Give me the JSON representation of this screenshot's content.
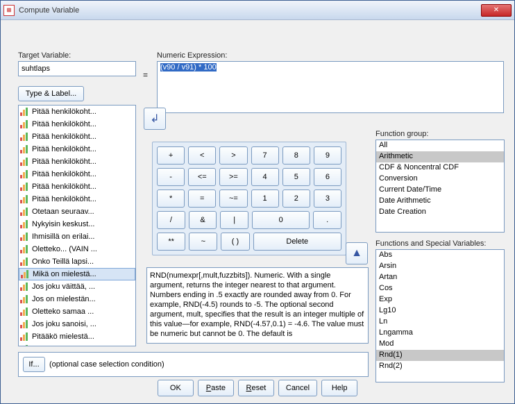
{
  "window": {
    "title": "Compute Variable"
  },
  "target": {
    "label": "Target Variable:",
    "value": "suhtlaps",
    "type_label_btn": "Type & Label..."
  },
  "eq": "=",
  "expression": {
    "label": "Numeric Expression:",
    "value": "(v90 / v91) * 100"
  },
  "variables": [
    "Pitää henkilökoht...",
    "Pitää henkilököht...",
    "Pitää henkilököht...",
    "Pitää henkilököht...",
    "Pitää henkilököht...",
    "Pitää henkilököht...",
    "Pitää henkilököht...",
    "Pitää henkilököht...",
    "Otetaan seuraav...",
    "Nykyisin keskust...",
    "Ihmisillä on erilai...",
    "Oletteko... (VAIN ...",
    "Onko Teillä lapsi...",
    "Mikä on mielestä...",
    "Jos joku väittää, ...",
    "Jos on mielestän...",
    "Oletteko samaa ...",
    "Jos joku sanoisi, ...",
    "Pitääkö mielestä...",
    "Onko mielestänn..."
  ],
  "variables_selected_index": 13,
  "keypad": {
    "rows": [
      [
        "+",
        "<",
        ">",
        "7",
        "8",
        "9"
      ],
      [
        "-",
        "<=",
        ">=",
        "4",
        "5",
        "6"
      ],
      [
        "*",
        "=",
        "~=",
        "1",
        "2",
        "3"
      ],
      [
        "/",
        "&",
        "|",
        "0",
        ".",
        " "
      ],
      [
        "**",
        "~",
        "( )",
        "Delete"
      ]
    ]
  },
  "function_group": {
    "label": "Function group:",
    "items": [
      "All",
      "Arithmetic",
      "CDF & Noncentral CDF",
      "Conversion",
      "Current Date/Time",
      "Date Arithmetic",
      "Date Creation"
    ],
    "selected_index": 1
  },
  "functions": {
    "label": "Functions and Special Variables:",
    "items": [
      "Abs",
      "Arsin",
      "Artan",
      "Cos",
      "Exp",
      "Lg10",
      "Ln",
      "Lngamma",
      "Mod",
      "Rnd(1)",
      "Rnd(2)"
    ],
    "selected_index": 9
  },
  "description": "RND(numexpr[,mult,fuzzbits]). Numeric. With a single argument, returns the integer nearest to that argument. Numbers ending in .5 exactly are rounded away from 0. For example, RND(-4.5) rounds to -5. The optional second argument, mult, specifies that the result is an integer multiple of this value—for example, RND(-4.57,0.1) = -4.6. The value must be numeric but cannot be 0. The default is",
  "if_section": {
    "btn": "If...",
    "text": "(optional case selection condition)"
  },
  "buttons": {
    "ok": "OK",
    "paste": "Paste",
    "reset": "Reset",
    "cancel": "Cancel",
    "help": "Help"
  }
}
